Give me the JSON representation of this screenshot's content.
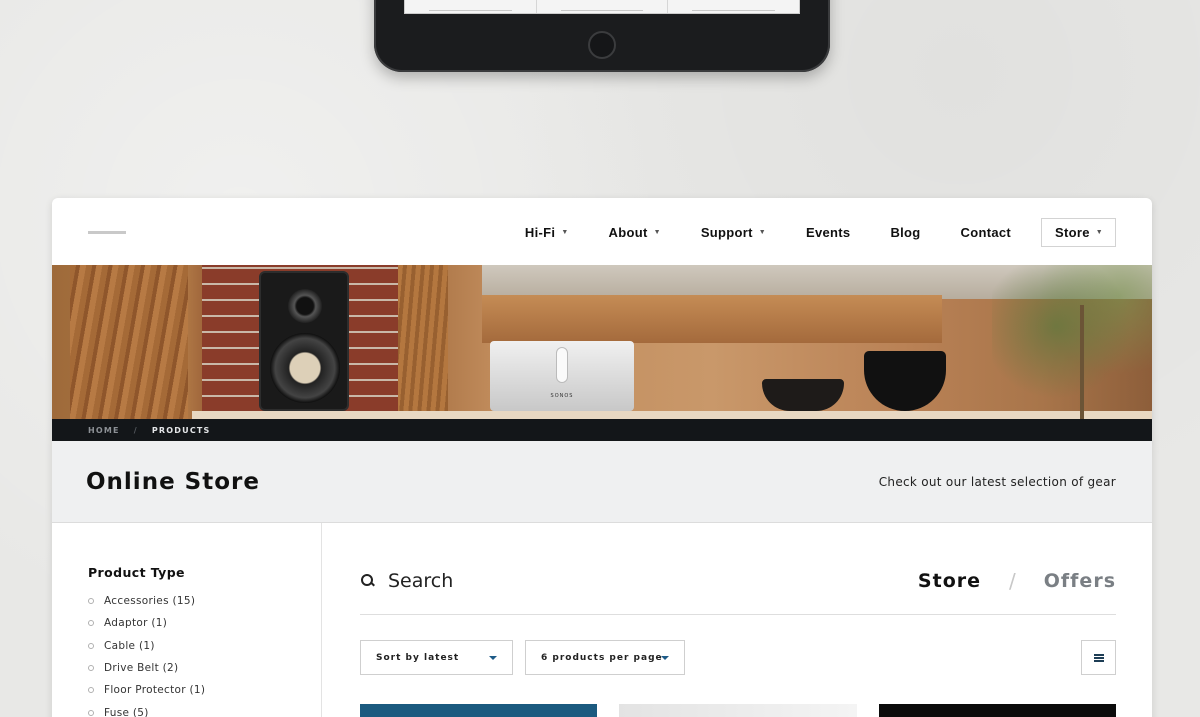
{
  "nav": {
    "items": [
      {
        "label": "Hi-Fi",
        "has_dropdown": true
      },
      {
        "label": "About",
        "has_dropdown": true
      },
      {
        "label": "Support",
        "has_dropdown": true
      },
      {
        "label": "Events",
        "has_dropdown": false
      },
      {
        "label": "Blog",
        "has_dropdown": false
      },
      {
        "label": "Contact",
        "has_dropdown": false
      }
    ],
    "store": {
      "label": "Store",
      "has_dropdown": true
    }
  },
  "hero": {
    "product_brand": "SONOS"
  },
  "breadcrumb": {
    "home": "HOME",
    "separator": "/",
    "current": "PRODUCTS"
  },
  "page": {
    "title": "Online Store",
    "subtitle": "Check out our latest selection of gear"
  },
  "sidebar": {
    "heading": "Product Type",
    "filters": [
      {
        "label": "Accessories (15)"
      },
      {
        "label": "Adaptor (1)"
      },
      {
        "label": "Cable (1)"
      },
      {
        "label": "Drive Belt (2)"
      },
      {
        "label": "Floor Protector (1)"
      },
      {
        "label": "Fuse (5)"
      }
    ]
  },
  "search": {
    "placeholder": "Search",
    "icon": "search-icon"
  },
  "tabs": {
    "active": "Store",
    "separator": "/",
    "inactive": "Offers"
  },
  "controls": {
    "sort": "Sort by latest",
    "per_page": "6 products per page",
    "view_icon": "list-view-icon"
  },
  "colors": {
    "accent": "#1d5b87",
    "breadcrumb_bg": "#131619",
    "title_band_bg": "#eff0f1",
    "product_card_1": "#1b5a7f",
    "product_card_3": "#0b0b0b"
  }
}
